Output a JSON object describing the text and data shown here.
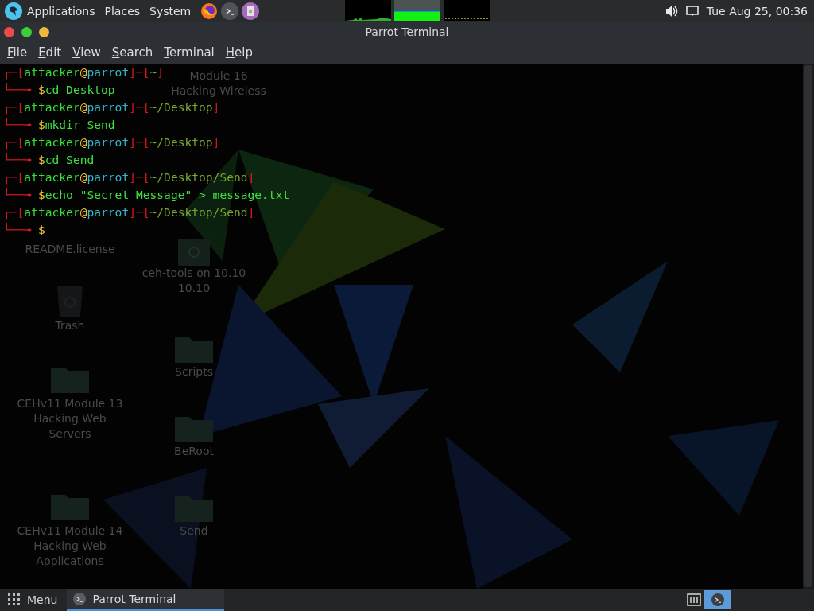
{
  "top_panel": {
    "menus": [
      "Applications",
      "Places",
      "System"
    ],
    "clock": "Tue Aug 25, 00:36"
  },
  "desktop": {
    "icons": [
      {
        "label": "Module 16 Hacking Wireless"
      },
      {
        "label": "README.license"
      },
      {
        "label": "ceh-tools on 10.10 10.10",
        "kind": "share"
      },
      {
        "label": "Trash",
        "kind": "trash"
      },
      {
        "label": "Scripts",
        "kind": "folder"
      },
      {
        "label": "CEHv11 Module 13 Hacking Web Servers",
        "kind": "folder"
      },
      {
        "label": "BeRoot",
        "kind": "folder"
      },
      {
        "label": "CEHv11 Module 14 Hacking Web Applications",
        "kind": "folder"
      },
      {
        "label": "Send",
        "kind": "folder"
      }
    ]
  },
  "window": {
    "title": "Parrot Terminal",
    "menu": [
      "File",
      "Edit",
      "View",
      "Search",
      "Terminal",
      "Help"
    ]
  },
  "terminal": {
    "lines": [
      {
        "segments": [
          {
            "text": "┌─[",
            "kind": "frame"
          },
          {
            "text": "attacker",
            "kind": "user"
          },
          {
            "text": "@",
            "kind": "at"
          },
          {
            "text": "parrot",
            "kind": "host"
          },
          {
            "text": "]─[",
            "kind": "frame"
          },
          {
            "text": "~",
            "kind": "path"
          },
          {
            "text": "]",
            "kind": "frame"
          }
        ]
      },
      {
        "segments": [
          {
            "text": "└──╼ ",
            "kind": "frame"
          },
          {
            "text": "$",
            "kind": "dollar"
          },
          {
            "text": "cd Desktop",
            "kind": "command"
          }
        ]
      },
      {
        "segments": [
          {
            "text": "┌─[",
            "kind": "frame"
          },
          {
            "text": "attacker",
            "kind": "user"
          },
          {
            "text": "@",
            "kind": "at"
          },
          {
            "text": "parrot",
            "kind": "host"
          },
          {
            "text": "]─[",
            "kind": "frame"
          },
          {
            "text": "~/Desktop",
            "kind": "path"
          },
          {
            "text": "]",
            "kind": "frame"
          }
        ]
      },
      {
        "segments": [
          {
            "text": "└──╼ ",
            "kind": "frame"
          },
          {
            "text": "$",
            "kind": "dollar"
          },
          {
            "text": "mkdir Send",
            "kind": "command"
          }
        ]
      },
      {
        "segments": [
          {
            "text": "┌─[",
            "kind": "frame"
          },
          {
            "text": "attacker",
            "kind": "user"
          },
          {
            "text": "@",
            "kind": "at"
          },
          {
            "text": "parrot",
            "kind": "host"
          },
          {
            "text": "]─[",
            "kind": "frame"
          },
          {
            "text": "~/Desktop",
            "kind": "path"
          },
          {
            "text": "]",
            "kind": "frame"
          }
        ]
      },
      {
        "segments": [
          {
            "text": "└──╼ ",
            "kind": "frame"
          },
          {
            "text": "$",
            "kind": "dollar"
          },
          {
            "text": "cd Send",
            "kind": "command"
          }
        ]
      },
      {
        "segments": [
          {
            "text": "┌─[",
            "kind": "frame"
          },
          {
            "text": "attacker",
            "kind": "user"
          },
          {
            "text": "@",
            "kind": "at"
          },
          {
            "text": "parrot",
            "kind": "host"
          },
          {
            "text": "]─[",
            "kind": "frame"
          },
          {
            "text": "~/Desktop/Send",
            "kind": "path"
          },
          {
            "text": "]",
            "kind": "frame"
          }
        ]
      },
      {
        "segments": [
          {
            "text": "└──╼ ",
            "kind": "frame"
          },
          {
            "text": "$",
            "kind": "dollar"
          },
          {
            "text": "echo \"Secret Message\" > message.txt",
            "kind": "command"
          }
        ]
      },
      {
        "segments": [
          {
            "text": "┌─[",
            "kind": "frame"
          },
          {
            "text": "attacker",
            "kind": "user"
          },
          {
            "text": "@",
            "kind": "at"
          },
          {
            "text": "parrot",
            "kind": "host"
          },
          {
            "text": "]─[",
            "kind": "frame"
          },
          {
            "text": "~/Desktop/Send",
            "kind": "path"
          },
          {
            "text": "]",
            "kind": "frame"
          }
        ]
      },
      {
        "segments": [
          {
            "text": "└──╼ ",
            "kind": "frame"
          },
          {
            "text": "$",
            "kind": "dollar"
          }
        ]
      }
    ]
  },
  "taskbar": {
    "menu": "Menu",
    "tasks": [
      {
        "label": "Parrot Terminal",
        "selected": true
      }
    ]
  }
}
